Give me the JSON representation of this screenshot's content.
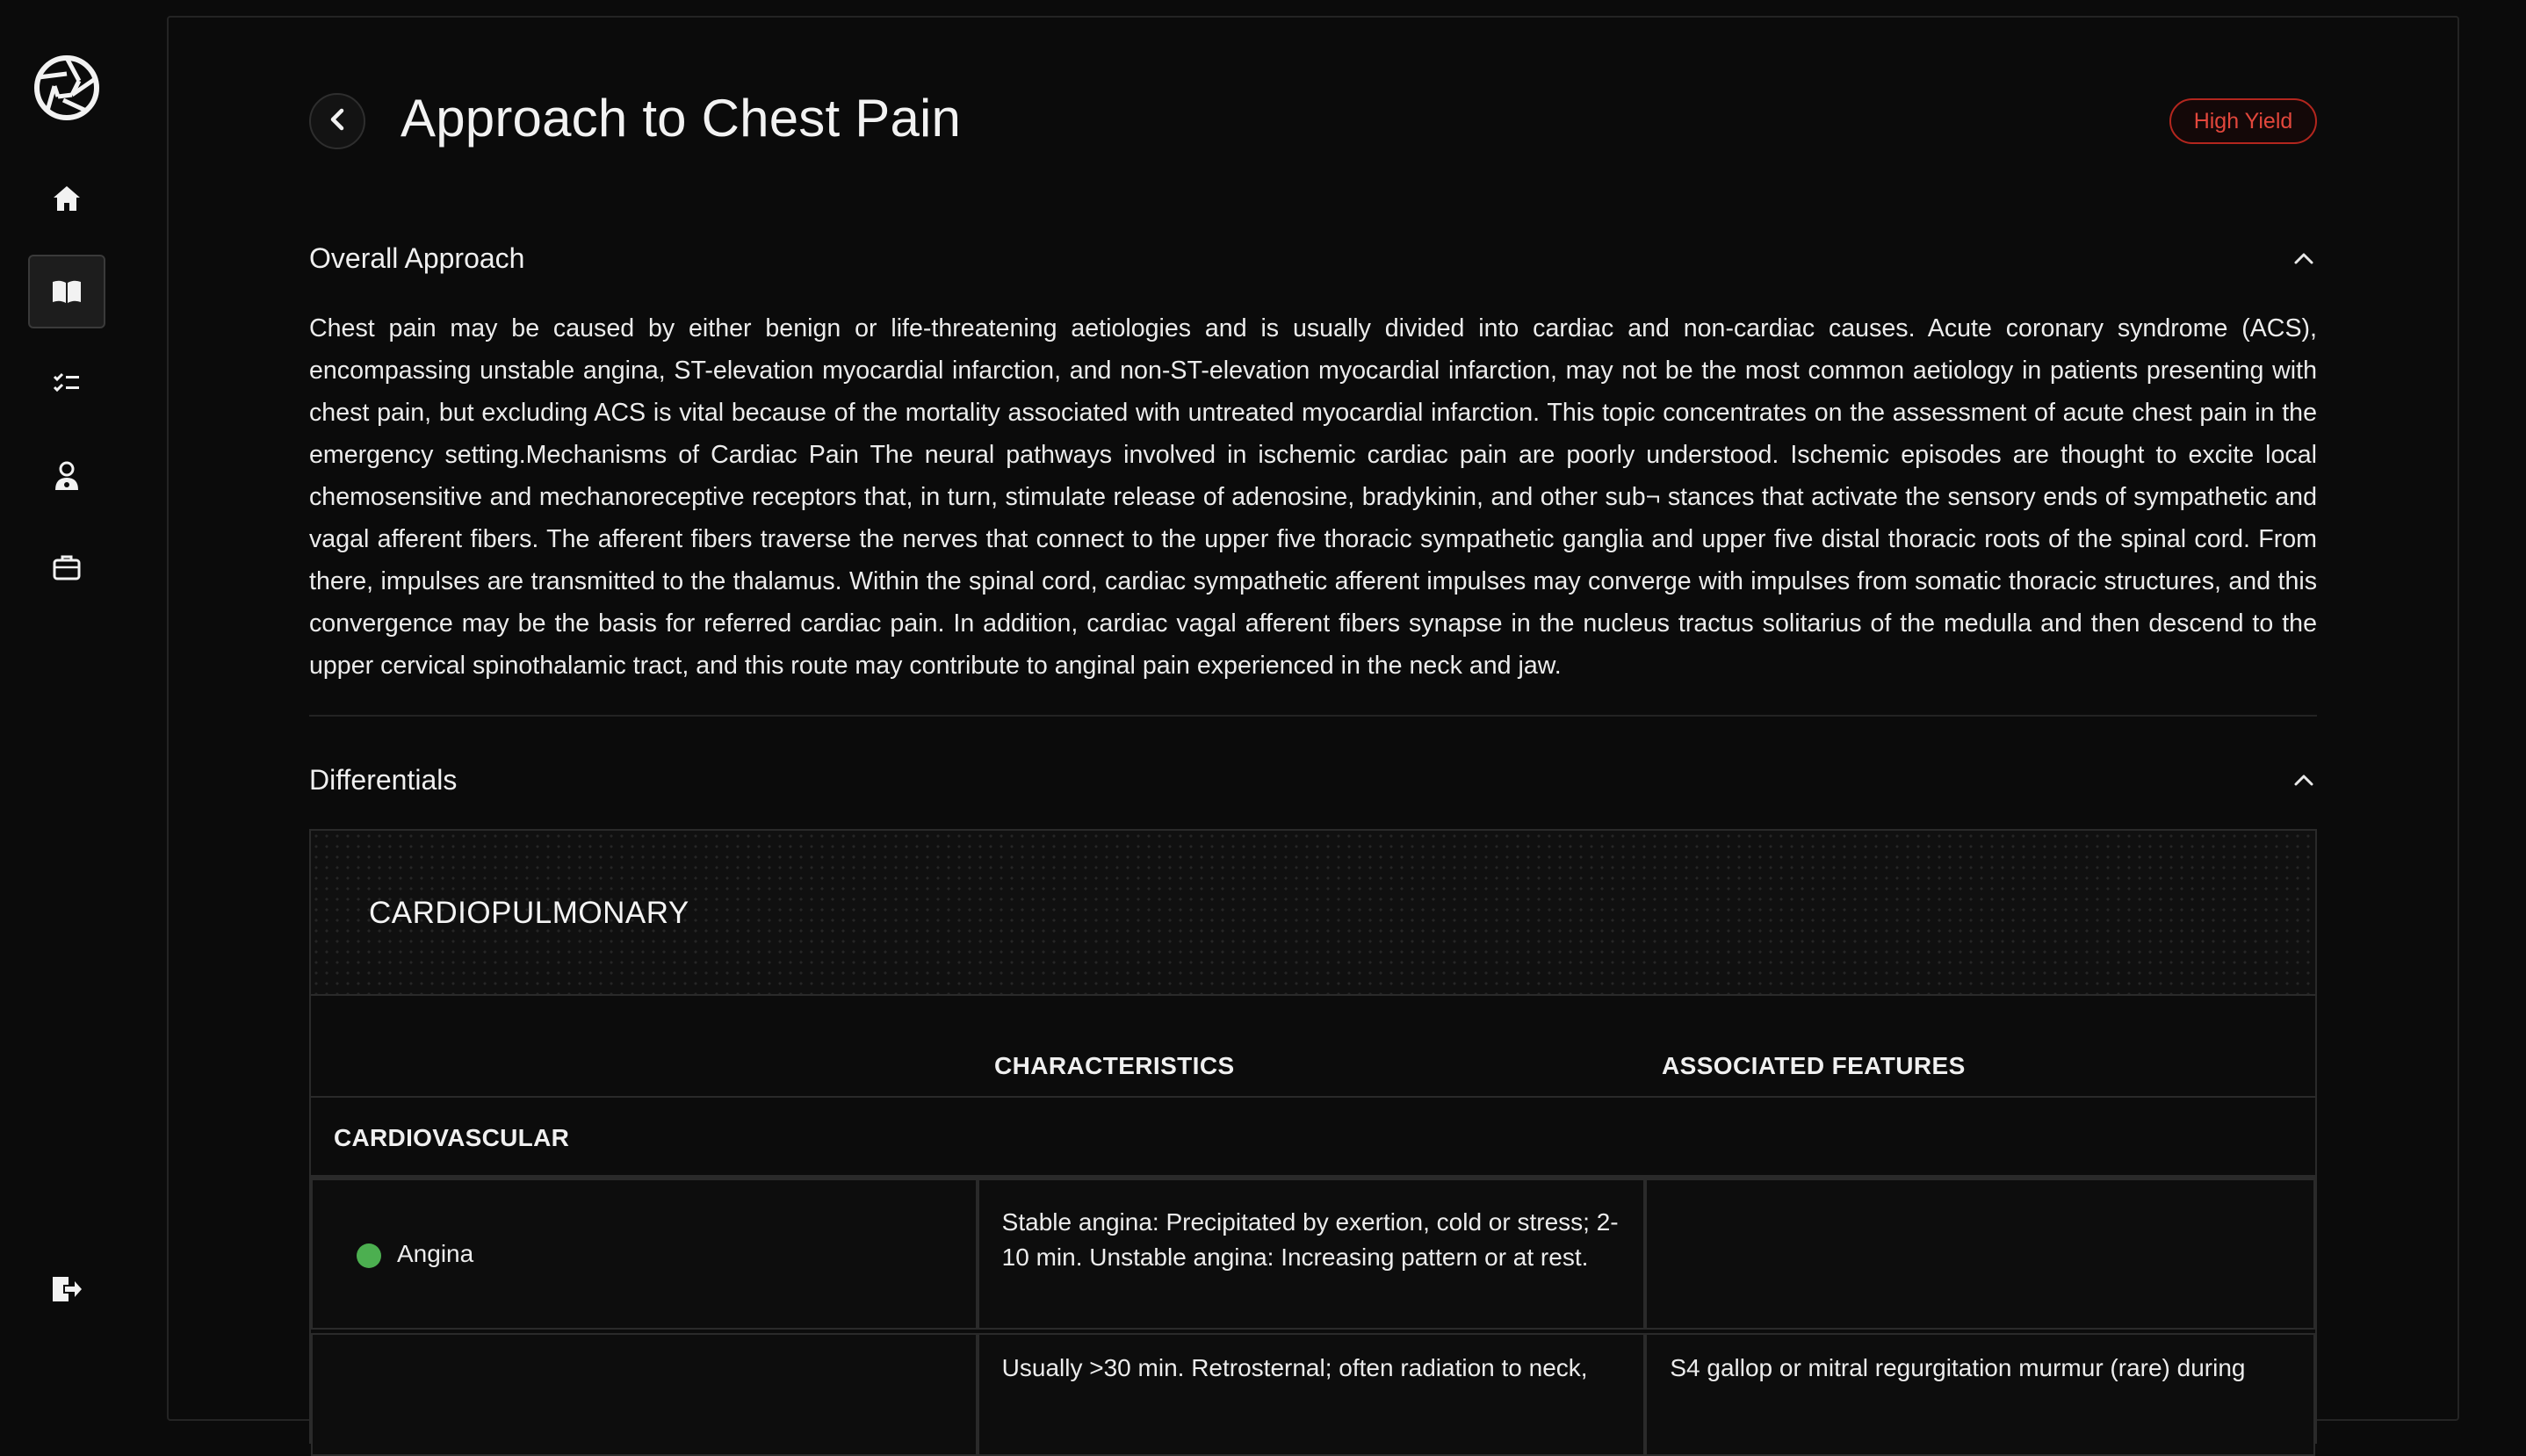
{
  "sidebar": {
    "items": [
      {
        "name": "home",
        "icon": "home-icon"
      },
      {
        "name": "library",
        "icon": "open-book-icon",
        "active": true
      },
      {
        "name": "checklist",
        "icon": "checklist-icon"
      },
      {
        "name": "doctor",
        "icon": "doctor-icon"
      },
      {
        "name": "cases",
        "icon": "briefcase-icon"
      }
    ],
    "logout_icon": "logout-icon"
  },
  "header": {
    "title": "Approach to Chest Pain",
    "badge": "High Yield",
    "badge_color": "#b3261e"
  },
  "sections": {
    "overall": {
      "title": "Overall Approach",
      "body": "Chest pain may be caused by either benign or life-threatening aetiologies and is usually divided into cardiac and non-cardiac causes. Acute coronary syndrome (ACS), encompassing unstable angina, ST-elevation myocardial infarction, and non-ST-elevation myocardial infarction, may not be the most common aetiology in patients presenting with chest pain, but excluding ACS is vital because of the mortality associated with untreated myocardial infarction. This topic concentrates on the assessment of acute chest pain in the emergency setting.Mechanisms of Cardiac Pain The neural pathways involved in ischemic cardiac pain are poorly understood. Ischemic episodes are thought to excite local chemosensitive and mechanoreceptive receptors that, in turn, stimulate release of adenosine, bradykinin, and other sub¬ stances that activate the sensory ends of sympathetic and vagal afferent fibers. The afferent fibers traverse the nerves that connect to the upper five thoracic sympathetic ganglia and upper five distal thoracic roots of the spinal cord. From there, impulses are transmitted to the thalamus. Within the spinal cord, cardiac sympathetic afferent impulses may converge with impulses from somatic thoracic structures, and this convergence may be the basis for referred cardiac pain. In addition, cardiac vagal afferent fibers synapse in the nucleus tractus solitarius of the medulla and then descend to the upper cervical spinothalamic tract, and this route may contribute to anginal pain experienced in the neck and jaw."
    },
    "differentials": {
      "title": "Differentials",
      "category": "CARDIOPULMONARY",
      "columns": [
        "CHARACTERISTICS",
        "ASSOCIATED FEATURES"
      ],
      "group": "CARDIOVASCULAR",
      "rows": [
        {
          "condition": "Angina",
          "dot_color": "#4caf50",
          "characteristics": "Stable angina: Precipitated by exertion, cold or stress; 2-10 min. Unstable angina: Increasing pattern or at rest.",
          "associated": ""
        },
        {
          "condition": "",
          "characteristics": "Usually >30 min. Retrosternal; often radiation to neck,",
          "associated": "S4 gallop or mitral regurgitation murmur (rare) during"
        }
      ]
    }
  },
  "colors": {
    "background": "#0b0b0b",
    "accent_red": "#e2473c",
    "status_green": "#4caf50"
  }
}
